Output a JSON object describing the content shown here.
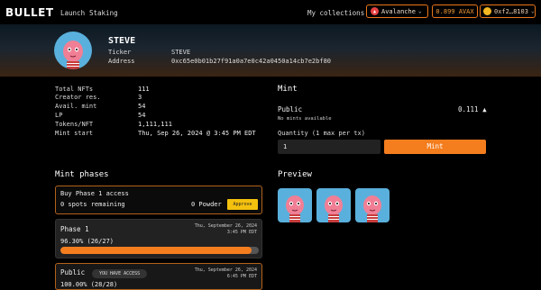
{
  "nav": {
    "logo": "BULLET",
    "links": [
      "Launch",
      "Staking"
    ],
    "my_collections": "My collections",
    "chain": "Avalanche",
    "balance": "0.899 AVAX",
    "wallet": "0xf2…8103"
  },
  "collection": {
    "name": "STEVE",
    "ticker_label": "Ticker",
    "ticker": "STEVE",
    "address_label": "Address",
    "address": "0xc65e0b01b27f91a0a7e0c42a0450a14cb7e2bf80"
  },
  "stats": [
    {
      "label": "Total NFTs",
      "value": "111"
    },
    {
      "label": "Creator res.",
      "value": "3"
    },
    {
      "label": "Avail. mint",
      "value": "54"
    },
    {
      "label": "LP",
      "value": "54"
    },
    {
      "label": "Tokens/NFT",
      "value": "1,111,111"
    },
    {
      "label": "Mint start",
      "value": "Thu, Sep 26, 2024 @ 3:45 PM EDT"
    }
  ],
  "mint": {
    "title": "Mint",
    "public_label": "Public",
    "price": "0.111",
    "no_mints": "No mints available",
    "quantity_label": "Quantity (1 max per tx)",
    "quantity_value": "1",
    "button": "Mint"
  },
  "phases": {
    "title": "Mint phases",
    "buy": {
      "title": "Buy Phase 1 access",
      "spots": "0 spots remaining",
      "cost": "0 Powder",
      "approve": "Approve"
    },
    "phase1": {
      "title": "Phase 1",
      "date1": "Thu, September 26, 2024",
      "date2": "3:45 PM EDT",
      "progress_text": "96.30% (26/27)",
      "progress": 0.963
    },
    "public": {
      "title": "Public",
      "badge": "YOU HAVE ACCESS",
      "date1": "Thu, September 26, 2024",
      "date2": "6:45 PM EDT",
      "progress_text": "100.00% (28/28)"
    }
  },
  "preview": {
    "title": "Preview",
    "count": 3
  },
  "colors": {
    "accent": "#f47d1e",
    "approve": "#f4c10f",
    "avatar_bg": "#5ab0dc"
  }
}
